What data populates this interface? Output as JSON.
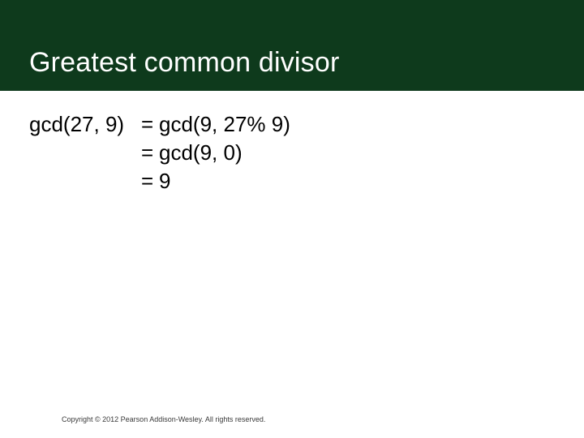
{
  "slide": {
    "title": "Greatest common divisor",
    "rows": [
      {
        "lhs": "gcd(27, 9)",
        "eq": "=",
        "rhs": "gcd(9, 27% 9)"
      },
      {
        "lhs": "",
        "eq": "=",
        "rhs": "gcd(9, 0)"
      },
      {
        "lhs": "",
        "eq": "=",
        "rhs": "9"
      }
    ],
    "footer": "Copyright © 2012 Pearson Addison-Wesley.  All rights reserved."
  }
}
